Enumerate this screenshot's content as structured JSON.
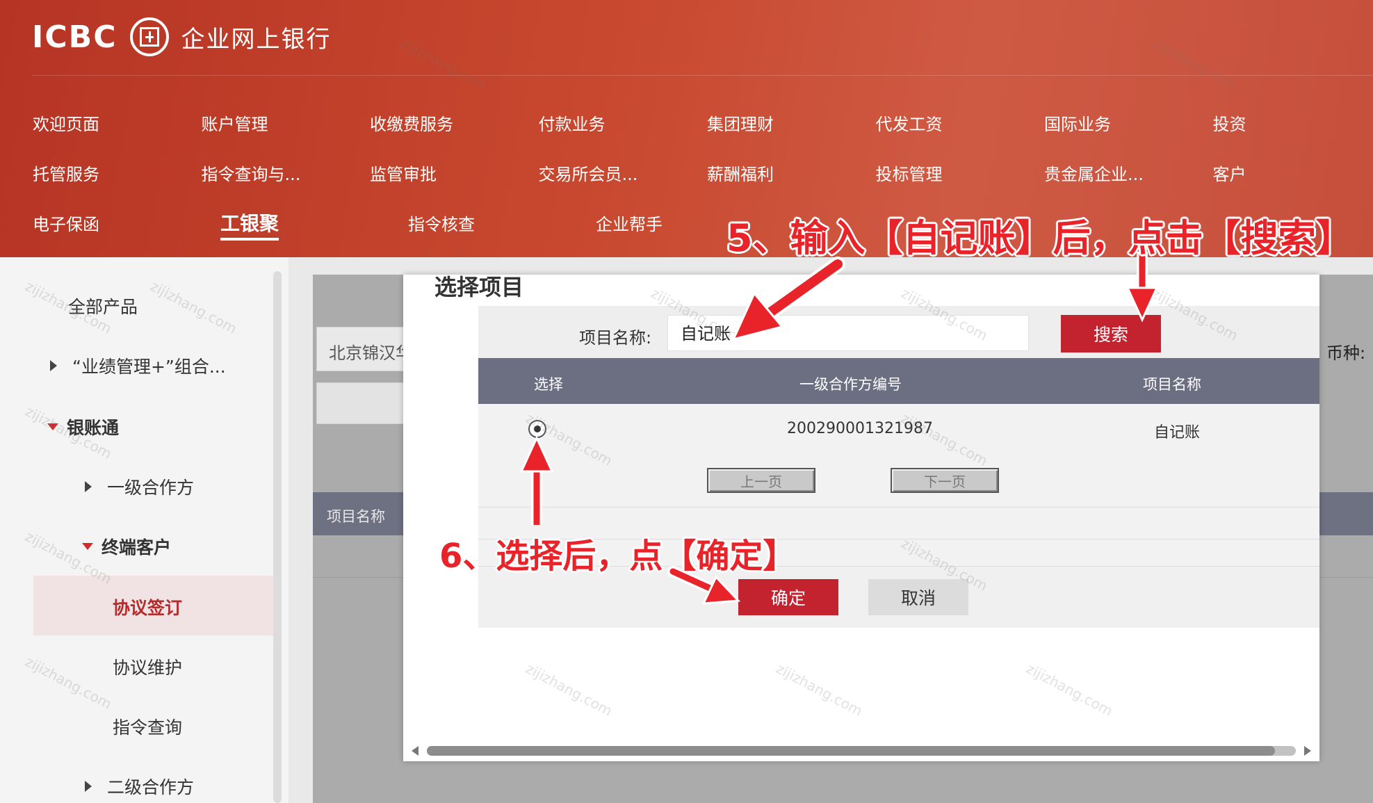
{
  "header": {
    "logo_text": "ICBC",
    "bank_name": "企业网上银行",
    "nav_rows": [
      [
        "欢迎页面",
        "账户管理",
        "收缴费服务",
        "付款业务",
        "集团理财",
        "代发工资",
        "国际业务",
        "投资"
      ],
      [
        "托管服务",
        "指令查询与...",
        "监管审批",
        "交易所会员...",
        "薪酬福利",
        "投标管理",
        "贵金属企业...",
        "客户"
      ],
      [
        "电子保函",
        "工银聚",
        "指令核查",
        "企业帮手"
      ]
    ],
    "active_nav": "工银聚"
  },
  "sidebar": {
    "items": [
      {
        "label": "全部产品"
      },
      {
        "label": "“业绩管理+”组合..."
      },
      {
        "label": "银账通"
      },
      {
        "label": "一级合作方"
      },
      {
        "label": "终端客户"
      },
      {
        "label": "协议签订"
      },
      {
        "label": "协议维护"
      },
      {
        "label": "指令查询"
      },
      {
        "label": "二级合作方"
      }
    ]
  },
  "content": {
    "field_text": "北京锦汉华",
    "column_header": "项目名称",
    "currency_label": "币种:"
  },
  "modal": {
    "title": "选择项目",
    "search_label": "项目名称:",
    "search_value": "自记账",
    "search_button": "搜索",
    "columns": [
      "选择",
      "一级合作方编号",
      "项目名称"
    ],
    "rows": [
      {
        "code": "200290001321987",
        "name": "自记账",
        "selected": true
      }
    ],
    "prev_page": "上一页",
    "next_page": "下一页",
    "ok_button": "确定",
    "cancel_button": "取消"
  },
  "annotations": {
    "step5": "5、输入【自记账】后，点击【搜索】",
    "step6": "6、选择后，点【确定】"
  },
  "watermark": "zijizhang.com",
  "colors": {
    "brand_red": "#c3232f",
    "annotation_red": "#e8242a",
    "table_header": "#6c6f81"
  }
}
